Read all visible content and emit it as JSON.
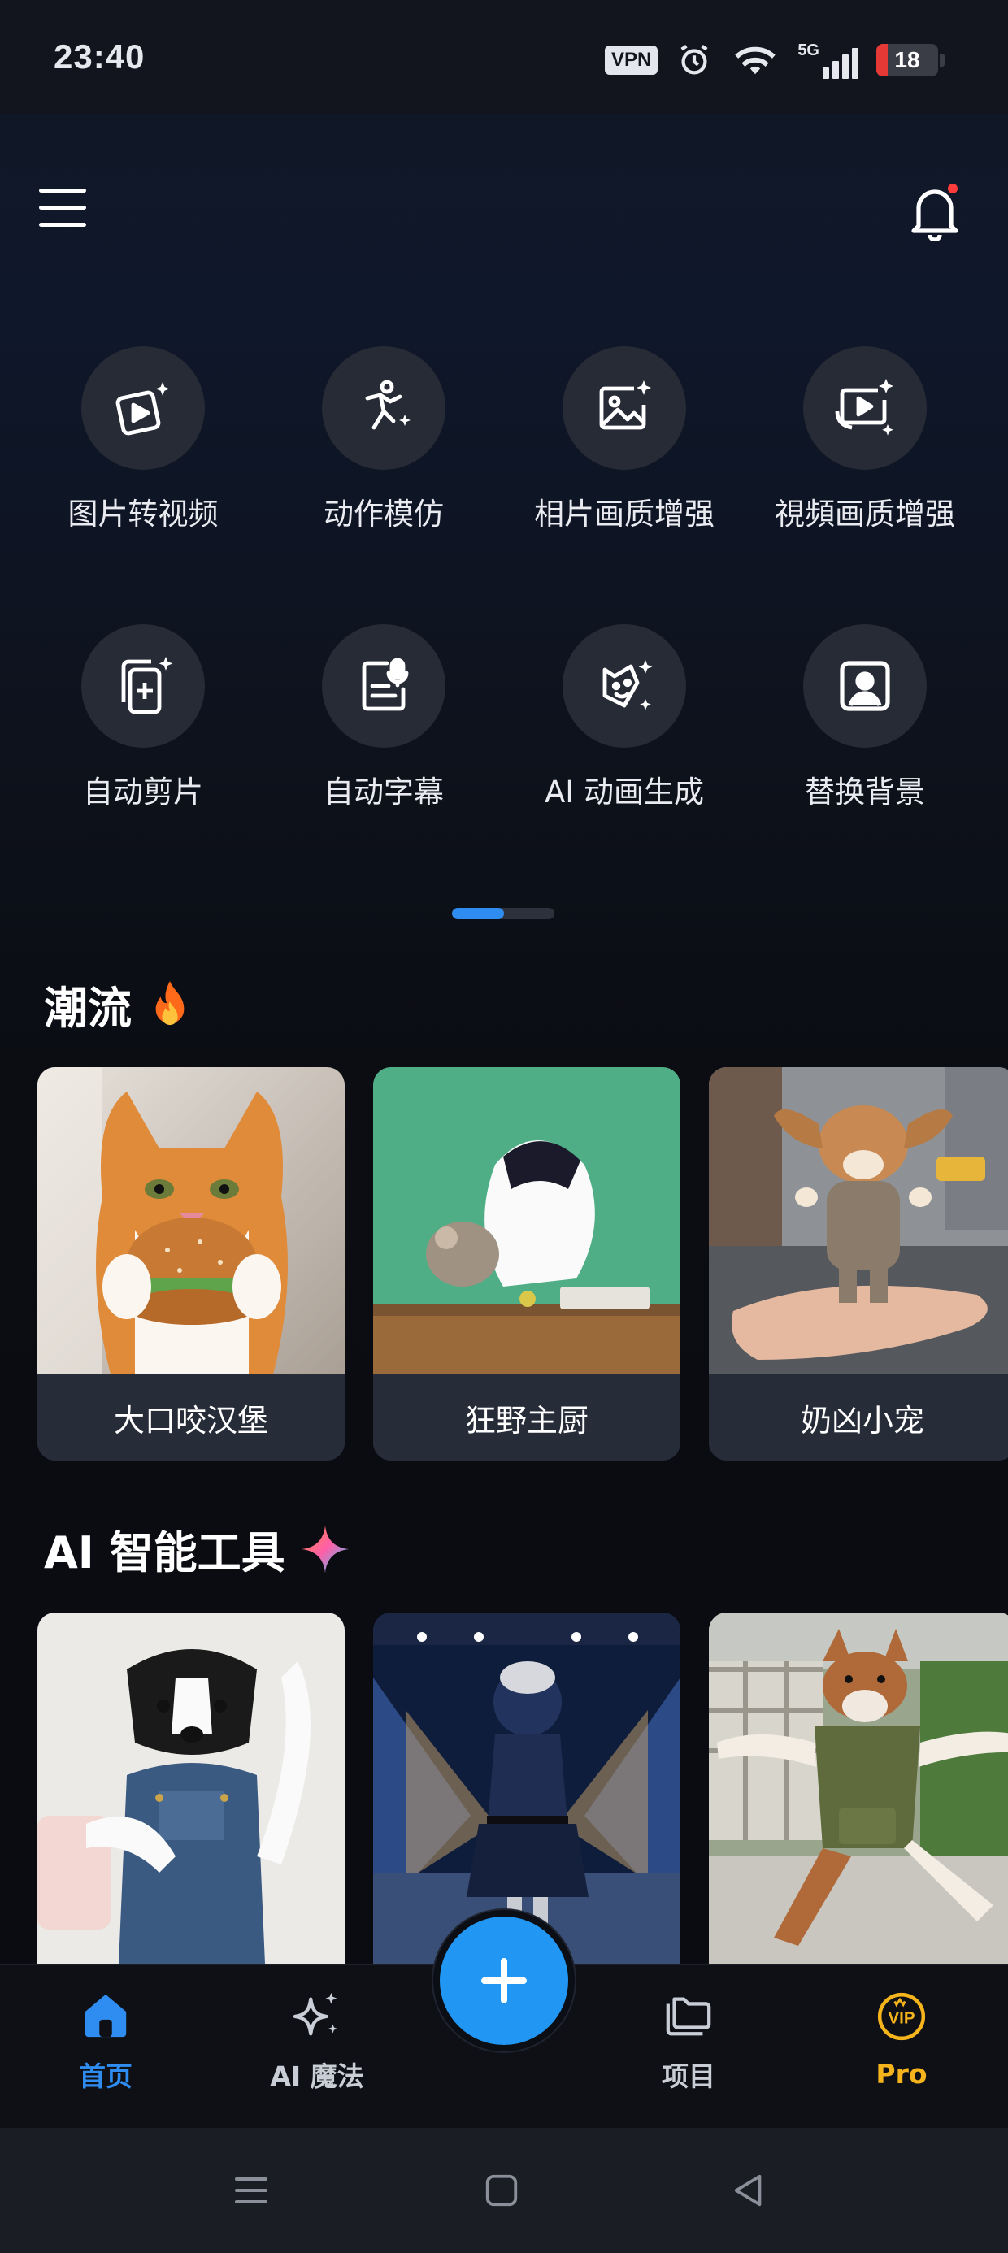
{
  "status_bar": {
    "time": "23:40",
    "vpn": "VPN",
    "network": "5G",
    "battery": "18",
    "battery_level_percent": 18,
    "icons": [
      "vpn-badge",
      "alarm-icon",
      "wifi-icon",
      "signal-5g-icon",
      "battery-icon"
    ]
  },
  "header": {
    "menu_icon": "menu-icon",
    "bell_icon": "bell-icon",
    "has_notification": true
  },
  "tools": [
    {
      "label": "图片转视频",
      "icon": "image-to-video-icon"
    },
    {
      "label": "动作模仿",
      "icon": "motion-mimic-icon"
    },
    {
      "label": "相片画质增强",
      "icon": "photo-enhance-icon"
    },
    {
      "label": "視頻画质增强",
      "icon": "video-enhance-icon"
    },
    {
      "label": "自动剪片",
      "icon": "auto-cut-icon"
    },
    {
      "label": "自动字幕",
      "icon": "auto-caption-icon"
    },
    {
      "label": "AI 动画生成",
      "icon": "ai-animation-icon"
    },
    {
      "label": "替换背景",
      "icon": "replace-background-icon"
    }
  ],
  "pager": {
    "pages": 2,
    "active": 1
  },
  "trending": {
    "title": "潮流",
    "emoji": "🔥",
    "cards": [
      {
        "label": "大口咬汉堡"
      },
      {
        "label": "狂野主厨"
      },
      {
        "label": "奶凶小宠"
      }
    ]
  },
  "ai_tools": {
    "title": "AI 智能工具",
    "icon": "sparkle-icon",
    "cards": [
      {
        "label": ""
      },
      {
        "label": ""
      },
      {
        "label": ""
      }
    ]
  },
  "bottom_nav": {
    "items": [
      {
        "label": "首页",
        "icon": "home-icon",
        "active": true,
        "color": "#2f8cf0"
      },
      {
        "label": "AI 魔法",
        "icon": "ai-magic-icon",
        "active": false,
        "color": "#c9cdd6"
      },
      {
        "label": "项目",
        "icon": "folder-icon",
        "active": false,
        "color": "#c9cdd6"
      },
      {
        "label": "Pro",
        "icon": "vip-icon",
        "active": false,
        "color": "#f5b31c"
      }
    ],
    "fab_icon": "plus-icon"
  },
  "system_nav": [
    "recents-icon",
    "home-square-icon",
    "back-triangle-icon"
  ],
  "colors": {
    "accent": "#2196f3",
    "pro": "#f5b31c",
    "notification": "#ff3b3b",
    "battery_low": "#e53935"
  }
}
